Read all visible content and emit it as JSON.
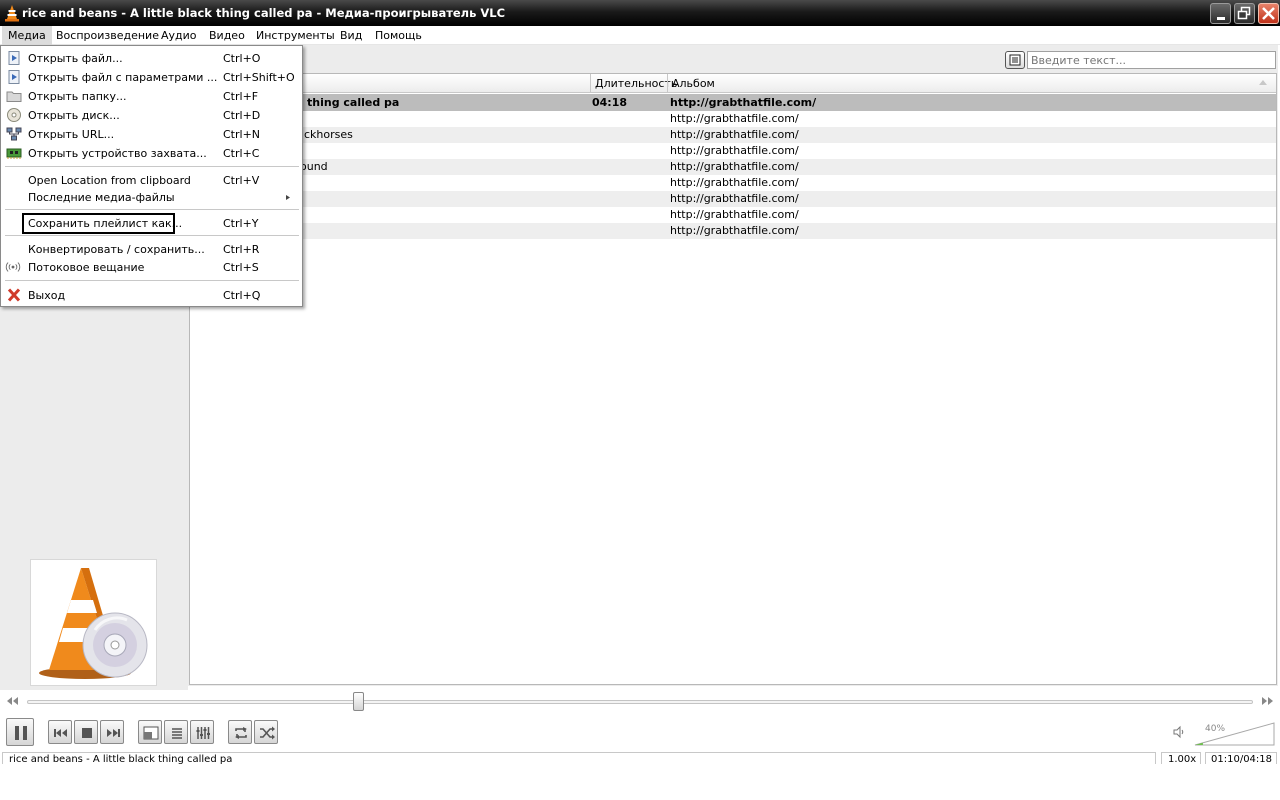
{
  "window": {
    "title": "rice and beans - A little black thing called pa - Медиа-проигрыватель VLC"
  },
  "menubar": {
    "items": [
      "Медиа",
      "Воспроизведение",
      "Аудио",
      "Видео",
      "Инструменты",
      "Вид",
      "Помощь"
    ],
    "active_index": 0
  },
  "media_menu": {
    "items": [
      {
        "label": "Открыть файл...",
        "shortcut": "Ctrl+O",
        "icon": "open-file-icon"
      },
      {
        "label": "Открыть файл с параметрами ...",
        "shortcut": "Ctrl+Shift+O",
        "icon": "open-file-advanced-icon"
      },
      {
        "label": "Открыть папку...",
        "shortcut": "Ctrl+F",
        "icon": "folder-icon"
      },
      {
        "label": "Открыть диск...",
        "shortcut": "Ctrl+D",
        "icon": "disc-icon"
      },
      {
        "label": "Открыть URL...",
        "shortcut": "Ctrl+N",
        "icon": "network-icon"
      },
      {
        "label": "Открыть устройство захвата...",
        "shortcut": "Ctrl+C",
        "icon": "capture-card-icon"
      },
      {
        "label": "Open Location from clipboard",
        "shortcut": "Ctrl+V"
      },
      {
        "label": "Последние медиа-файлы",
        "shortcut": "",
        "submenu": true
      },
      {
        "label": "Сохранить плейлист как...",
        "shortcut": "Ctrl+Y",
        "focused": true
      },
      {
        "label": "Конвертировать / сохранить...",
        "shortcut": "Ctrl+R"
      },
      {
        "label": "Потоковое вещание",
        "shortcut": "Ctrl+S",
        "icon": "stream-icon"
      },
      {
        "label": "Выход",
        "shortcut": "Ctrl+Q",
        "icon": "exit-icon"
      }
    ]
  },
  "search": {
    "placeholder": "Введите текст..."
  },
  "playlist": {
    "columns": [
      "Длительность",
      "Альбом"
    ],
    "rows": [
      {
        "title_fragment": "thing called pa",
        "duration": "04:18",
        "album": "http://grabthatfile.com/",
        "current": true
      },
      {
        "title_fragment": "",
        "duration": "",
        "album": "http://grabthatfile.com/"
      },
      {
        "title_fragment": "ckhorses",
        "duration": "",
        "album": "http://grabthatfile.com/"
      },
      {
        "title_fragment": "",
        "duration": "",
        "album": "http://grabthatfile.com/"
      },
      {
        "title_fragment": "ound",
        "duration": "",
        "album": "http://grabthatfile.com/"
      },
      {
        "title_fragment": "",
        "duration": "",
        "album": "http://grabthatfile.com/"
      },
      {
        "title_fragment": "",
        "duration": "",
        "album": "http://grabthatfile.com/"
      },
      {
        "title_fragment": "",
        "duration": "",
        "album": "http://grabthatfile.com/"
      },
      {
        "title_fragment": "",
        "duration": "",
        "album": "http://grabthatfile.com/"
      }
    ]
  },
  "playback": {
    "seek_position_fraction": 0.27,
    "volume_label": "40%",
    "volume_fraction": 0.4
  },
  "status": {
    "now_playing": "rice and beans - A little black thing called pa",
    "rate": "1.00x",
    "time": "01:10/04:18"
  },
  "colors": {
    "vlc_orange": "#f08a1c",
    "close_red": "#d0402a",
    "volume_green": "#6cc04a"
  }
}
